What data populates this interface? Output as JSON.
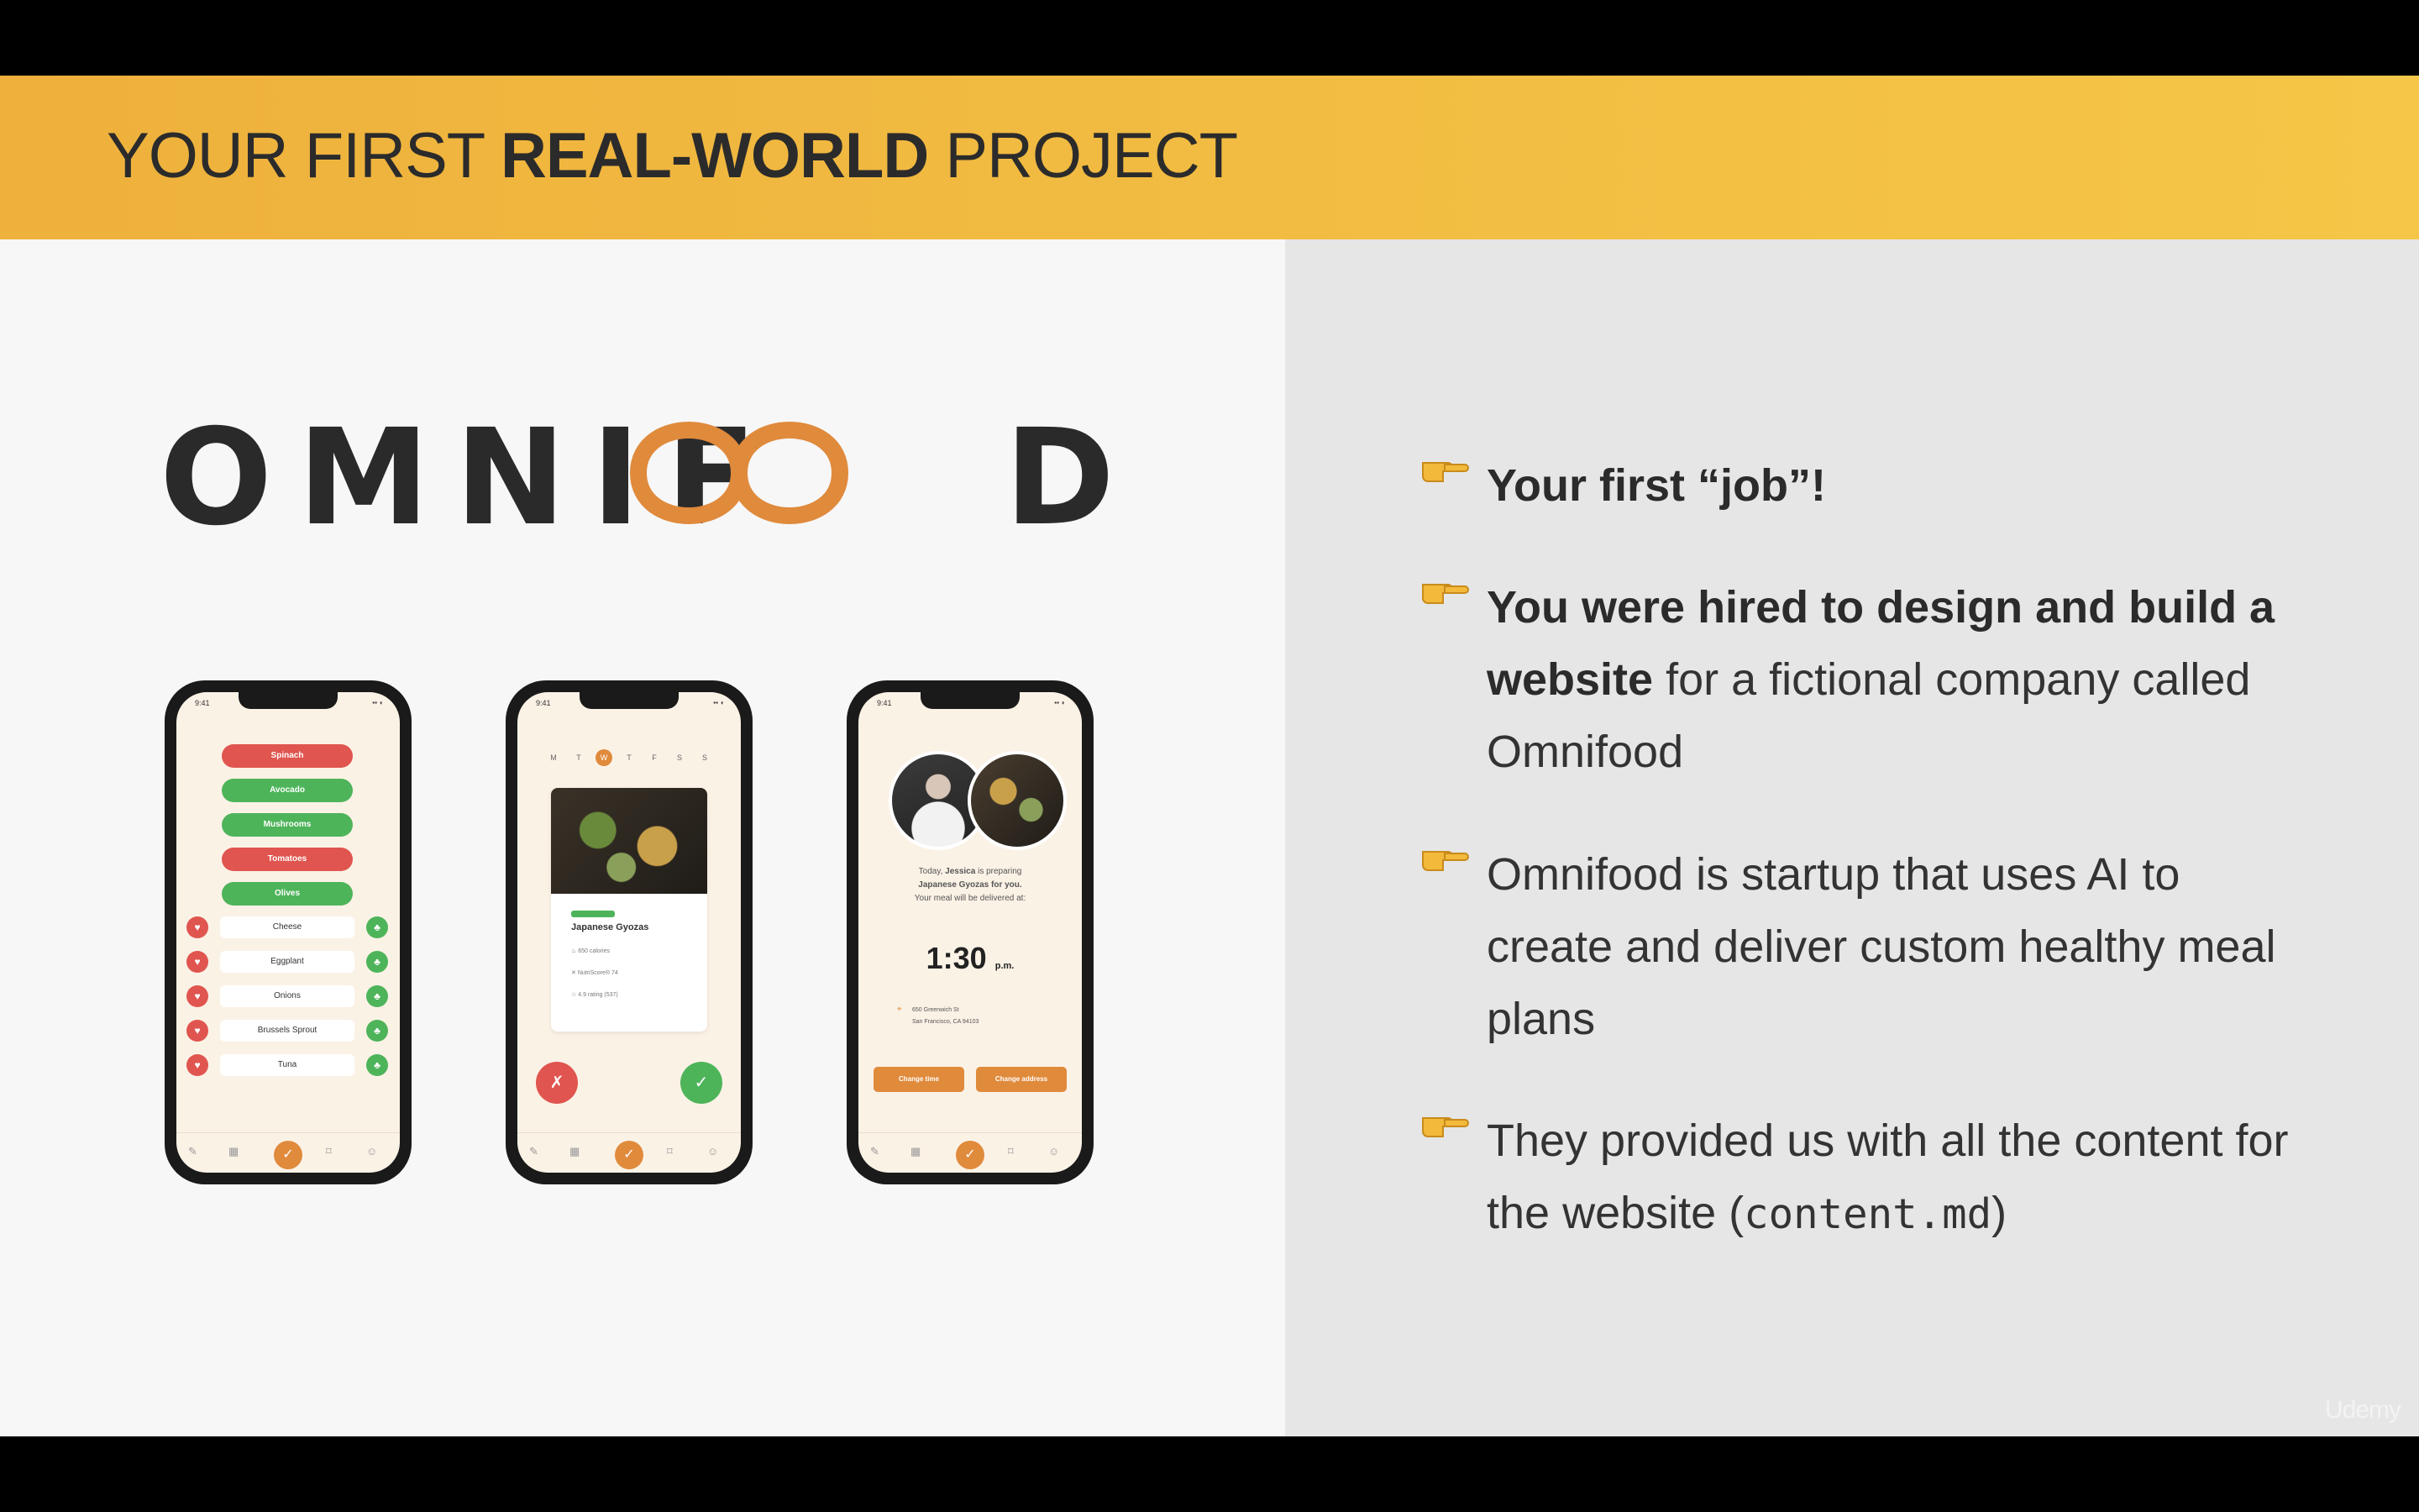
{
  "header": {
    "title_prefix": "YOUR FIRST ",
    "title_bold": "REAL-WORLD",
    "title_suffix": " PROJECT"
  },
  "logo": {
    "text": "OMNIFOOD",
    "brand_color": "#e08a3c"
  },
  "phone1": {
    "status_time": "9:41",
    "pills": [
      {
        "label": "Spinach",
        "color": "red"
      },
      {
        "label": "Avocado",
        "color": "green"
      },
      {
        "label": "Mushrooms",
        "color": "green"
      },
      {
        "label": "Tomatoes",
        "color": "red"
      },
      {
        "label": "Olives",
        "color": "green"
      }
    ],
    "rows": [
      "Cheese",
      "Eggplant",
      "Onions",
      "Brussels Sprout",
      "Tuna"
    ]
  },
  "phone2": {
    "status_time": "9:41",
    "days": [
      "M",
      "T",
      "W",
      "T",
      "F",
      "S",
      "S"
    ],
    "active_day_index": 2,
    "meal_name": "Japanese Gyozas",
    "details": [
      "650 calories",
      "NutriScore® 74",
      "4.9 rating (537)"
    ]
  },
  "phone3": {
    "status_time": "9:41",
    "line1_prefix": "Today, ",
    "line1_name": "Jessica",
    "line1_suffix": " is preparing",
    "line2": "Japanese Gyozas for you.",
    "line3": "Your meal will be delivered at:",
    "time": "1:30",
    "time_suffix": "p.m.",
    "address_line1": "650 Greenwich St",
    "address_line2": "San Francisco, CA 94103",
    "button_time": "Change time",
    "button_address": "Change address"
  },
  "bullets": {
    "b1": "Your first “job”!",
    "b2_bold": "You were hired to design and build a website",
    "b2_rest": " for a fictional company called Omnifood",
    "b3": "Omnifood is startup that uses AI to create and deliver custom healthy meal plans",
    "b4_prefix": "They provided us with all the content for the website (",
    "b4_code": "content.md",
    "b4_suffix": ")"
  },
  "watermark": "Udemy"
}
